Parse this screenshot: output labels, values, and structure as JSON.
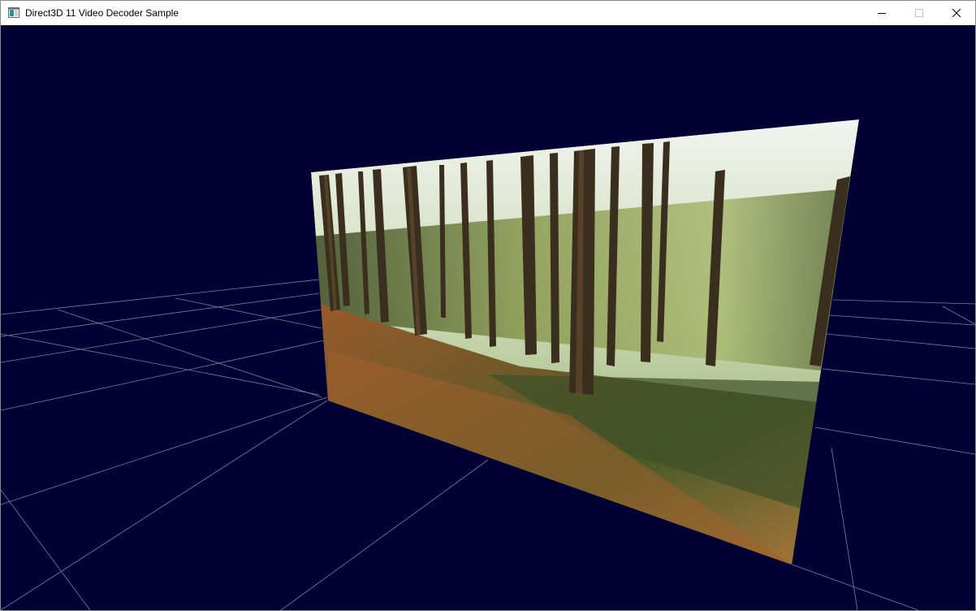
{
  "window": {
    "title": "Direct3D 11 Video Decoder Sample",
    "controls": {
      "minimize_icon": "minimize-icon",
      "maximize_icon": "maximize-icon",
      "close_icon": "close-icon"
    }
  },
  "scene": {
    "background_color": "#000033",
    "grid_line_color": "#8a8aa8",
    "video_frame_description_icon": "forest-video-frame"
  }
}
